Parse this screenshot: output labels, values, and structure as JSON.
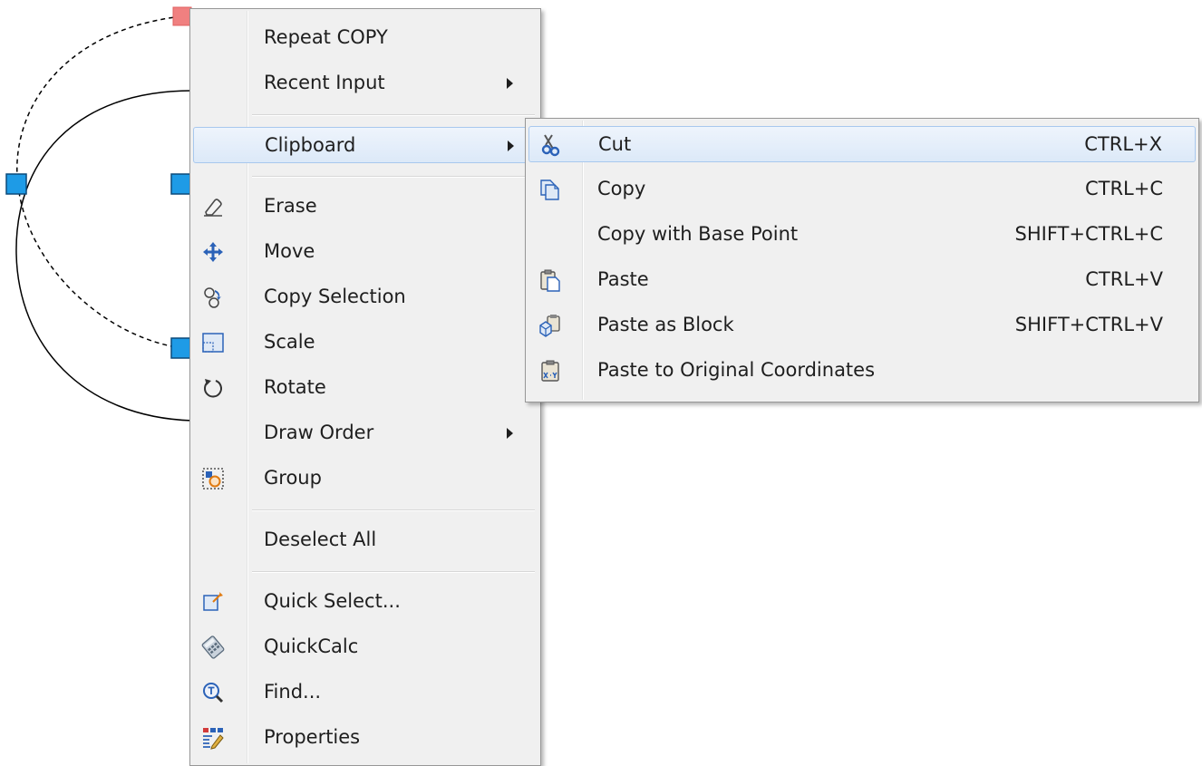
{
  "context_menu": {
    "items": [
      {
        "label": "Repeat COPY",
        "icon": ""
      },
      {
        "label": "Recent Input",
        "icon": "",
        "submenu": true
      },
      {
        "label": "Clipboard",
        "icon": "",
        "submenu": true,
        "highlighted": true
      },
      {
        "label": "Erase",
        "icon": "eraser-icon"
      },
      {
        "label": "Move",
        "icon": "move-arrows-icon"
      },
      {
        "label": "Copy Selection",
        "icon": "copy-objects-icon"
      },
      {
        "label": "Scale",
        "icon": "scale-icon"
      },
      {
        "label": "Rotate",
        "icon": "rotate-icon"
      },
      {
        "label": "Draw Order",
        "icon": "",
        "submenu": true
      },
      {
        "label": "Group",
        "icon": "group-icon"
      },
      {
        "label": "Deselect All",
        "icon": ""
      },
      {
        "label": "Quick Select...",
        "icon": "quick-select-icon"
      },
      {
        "label": "QuickCalc",
        "icon": "calculator-icon"
      },
      {
        "label": "Find...",
        "icon": "find-text-icon"
      },
      {
        "label": "Properties",
        "icon": "properties-icon"
      }
    ]
  },
  "clipboard_submenu": {
    "items": [
      {
        "label": "Cut",
        "shortcut": "CTRL+X",
        "icon": "scissors-icon",
        "highlighted": true
      },
      {
        "label": "Copy",
        "shortcut": "CTRL+C",
        "icon": "copy-icon"
      },
      {
        "label": "Copy with Base Point",
        "shortcut": "SHIFT+CTRL+C",
        "icon": ""
      },
      {
        "label": "Paste",
        "shortcut": "CTRL+V",
        "icon": "paste-icon"
      },
      {
        "label": "Paste as Block",
        "shortcut": "SHIFT+CTRL+V",
        "icon": "paste-block-icon"
      },
      {
        "label": "Paste to Original Coordinates",
        "shortcut": "",
        "icon": "paste-coordinates-icon"
      }
    ]
  },
  "colors": {
    "grip_selected": "#f08080",
    "grip_unselected": "#1e9be6",
    "highlight_border": "#a8c8ee",
    "menu_background": "#f0f0f0"
  }
}
